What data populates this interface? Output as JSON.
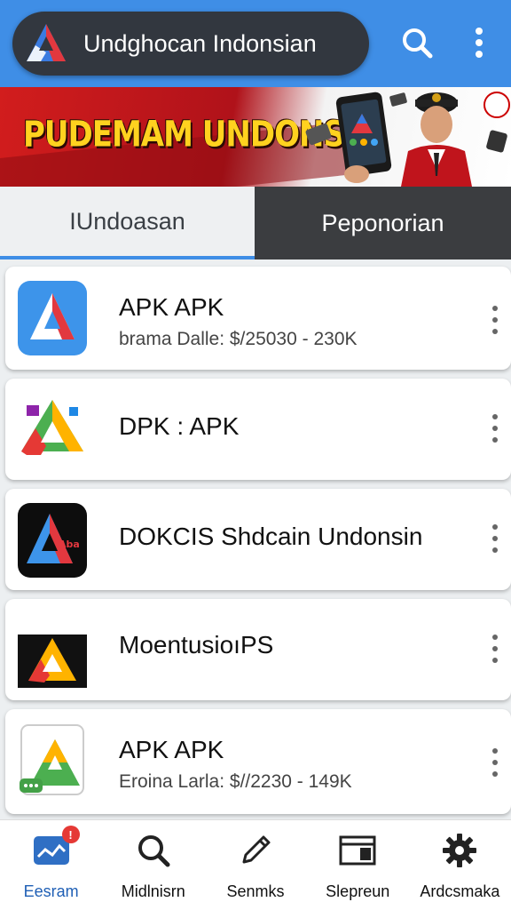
{
  "header": {
    "title": "Undghocan Indonsian",
    "search_icon": "search-icon",
    "menu_icon": "more-vert-icon",
    "bar_color": "#3f8ee6"
  },
  "banner": {
    "headline": "PUDEMAM UNDONSIA"
  },
  "tabs": [
    {
      "label": "IUndoasan",
      "active": true
    },
    {
      "label": "Peponorian",
      "active": false
    }
  ],
  "apps": [
    {
      "name": "APK APK",
      "subtitle": "brama Dalle: $/25030 - 230K",
      "icon": "apk-logo-blue"
    },
    {
      "name": "DPK : APK",
      "subtitle": "",
      "icon": "apk-logo-drive"
    },
    {
      "name": "DOKCIS Shdcain Undonsin",
      "subtitle": "",
      "icon": "apk-logo-black"
    },
    {
      "name": "MoentusioıPS",
      "subtitle": "",
      "icon": "apk-logo-dark"
    },
    {
      "name": "APK APK",
      "subtitle": "Eroina Larla: $//2230 - 149K",
      "icon": "apk-logo-chat"
    }
  ],
  "bottom_nav": [
    {
      "label": "Eesram",
      "icon": "chart-icon",
      "badge": "!",
      "active": true
    },
    {
      "label": "Midlnisrn",
      "icon": "search-icon",
      "active": false
    },
    {
      "label": "Senmks",
      "icon": "pencil-icon",
      "active": false
    },
    {
      "label": "Slepreun",
      "icon": "layout-icon",
      "active": false
    },
    {
      "label": "Ardcsmaka",
      "icon": "gear-icon",
      "active": false
    }
  ]
}
